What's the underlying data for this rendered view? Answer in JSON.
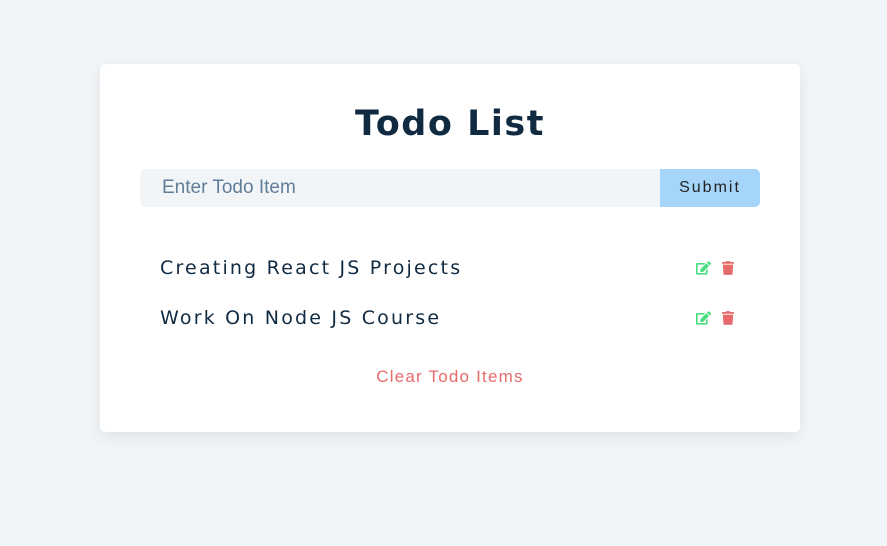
{
  "header": {
    "title": "Todo List"
  },
  "form": {
    "input_value": "",
    "input_placeholder": "Enter Todo Item",
    "submit_label": "Submit"
  },
  "todos": [
    {
      "text": "Creating React JS Projects",
      "edit_icon": "edit-icon",
      "delete_icon": "trash-icon"
    },
    {
      "text": "Work On Node JS Course",
      "edit_icon": "edit-icon",
      "delete_icon": "trash-icon"
    }
  ],
  "footer": {
    "clear_label": "Clear Todo Items"
  },
  "colors": {
    "background": "#f1f5f8",
    "card": "#ffffff",
    "title": "#102a42",
    "submit": "#a5d5f8",
    "edit": "#4ade80",
    "delete": "#e66b6b"
  }
}
